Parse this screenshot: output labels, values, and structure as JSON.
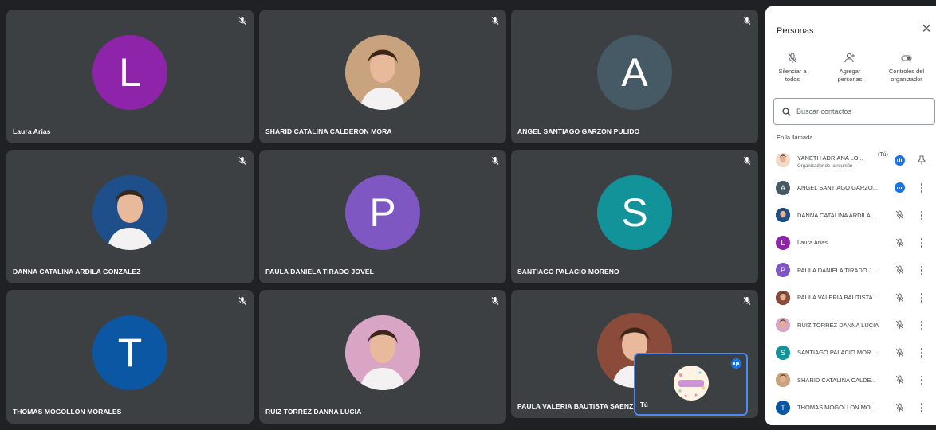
{
  "tiles": [
    {
      "name": "Laura Arias",
      "initial": "L",
      "color": "#8e24aa",
      "photo": false
    },
    {
      "name": "SHARID CATALINA CALDERON MORA",
      "initial": "",
      "color": "#c9a37e",
      "photo": true
    },
    {
      "name": "ANGEL SANTIAGO GARZON PULIDO",
      "initial": "A",
      "color": "#455a64",
      "photo": false
    },
    {
      "name": "DANNA CATALINA ARDILA GONZALEZ",
      "initial": "",
      "color": "#1f4f8a",
      "photo": true
    },
    {
      "name": "PAULA DANIELA TIRADO JOVEL",
      "initial": "P",
      "color": "#7e57c2",
      "photo": false
    },
    {
      "name": "SANTIAGO PALACIO MORENO",
      "initial": "S",
      "color": "#12939a",
      "photo": false
    },
    {
      "name": "THOMAS MOGOLLON MORALES",
      "initial": "T",
      "color": "#0b57a4",
      "photo": false
    },
    {
      "name": "RUIZ TORREZ DANNA LUCIA",
      "initial": "",
      "color": "#d9a5c5",
      "photo": true
    },
    {
      "name": "PAULA VALERIA BAUTISTA SAENZ",
      "initial": "",
      "color": "#8a4b3a",
      "photo": true
    }
  ],
  "self_view": {
    "name": "Tú"
  },
  "panel": {
    "title": "Personas",
    "close_icon": "close-icon",
    "actions": [
      {
        "label_line1": "Silenciar a",
        "label_line2": "todos",
        "icon": "mic-off-icon"
      },
      {
        "label_line1": "Agregar",
        "label_line2": "personas",
        "icon": "person-add-icon"
      },
      {
        "label_line1": "Controles del",
        "label_line2": "organizador",
        "icon": "toggle-icon"
      }
    ],
    "search_placeholder": "Buscar contactos",
    "section_label": "En la llamada",
    "participants": [
      {
        "name": "YANETH ADRIANA LO...",
        "you": "(Tú)",
        "subtitle": "Organizador de la reunión",
        "initial": "",
        "color": "#f3d9c8",
        "state": "speaking",
        "action": "pin"
      },
      {
        "name": "ANGEL SANTIAGO GARZO...",
        "you": "",
        "subtitle": "",
        "initial": "A",
        "color": "#455a64",
        "state": "speaking-dots",
        "action": "more"
      },
      {
        "name": "DANNA CATALINA ARDILA ...",
        "you": "",
        "subtitle": "",
        "initial": "",
        "color": "#1f4f8a",
        "state": "muted",
        "action": "more"
      },
      {
        "name": "Laura Arias",
        "you": "",
        "subtitle": "",
        "initial": "L",
        "color": "#8e24aa",
        "state": "muted",
        "action": "more"
      },
      {
        "name": "PAULA DANIELA TIRADO J...",
        "you": "",
        "subtitle": "",
        "initial": "P",
        "color": "#7e57c2",
        "state": "muted",
        "action": "more"
      },
      {
        "name": "PAULA VALERIA BAUTISTA ...",
        "you": "",
        "subtitle": "",
        "initial": "",
        "color": "#8a4b3a",
        "state": "muted",
        "action": "more"
      },
      {
        "name": "RUIZ TORREZ DANNA LUCIA",
        "you": "",
        "subtitle": "",
        "initial": "",
        "color": "#d9a5c5",
        "state": "muted",
        "action": "more"
      },
      {
        "name": "SANTIAGO PALACIO MOR...",
        "you": "",
        "subtitle": "",
        "initial": "S",
        "color": "#12939a",
        "state": "muted",
        "action": "more"
      },
      {
        "name": "SHARID CATALINA CALDE...",
        "you": "",
        "subtitle": "",
        "initial": "",
        "color": "#c9a37e",
        "state": "muted",
        "action": "more"
      },
      {
        "name": "THOMAS MOGOLLON MO...",
        "you": "",
        "subtitle": "",
        "initial": "T",
        "color": "#0b57a4",
        "state": "muted",
        "action": "more"
      }
    ]
  }
}
